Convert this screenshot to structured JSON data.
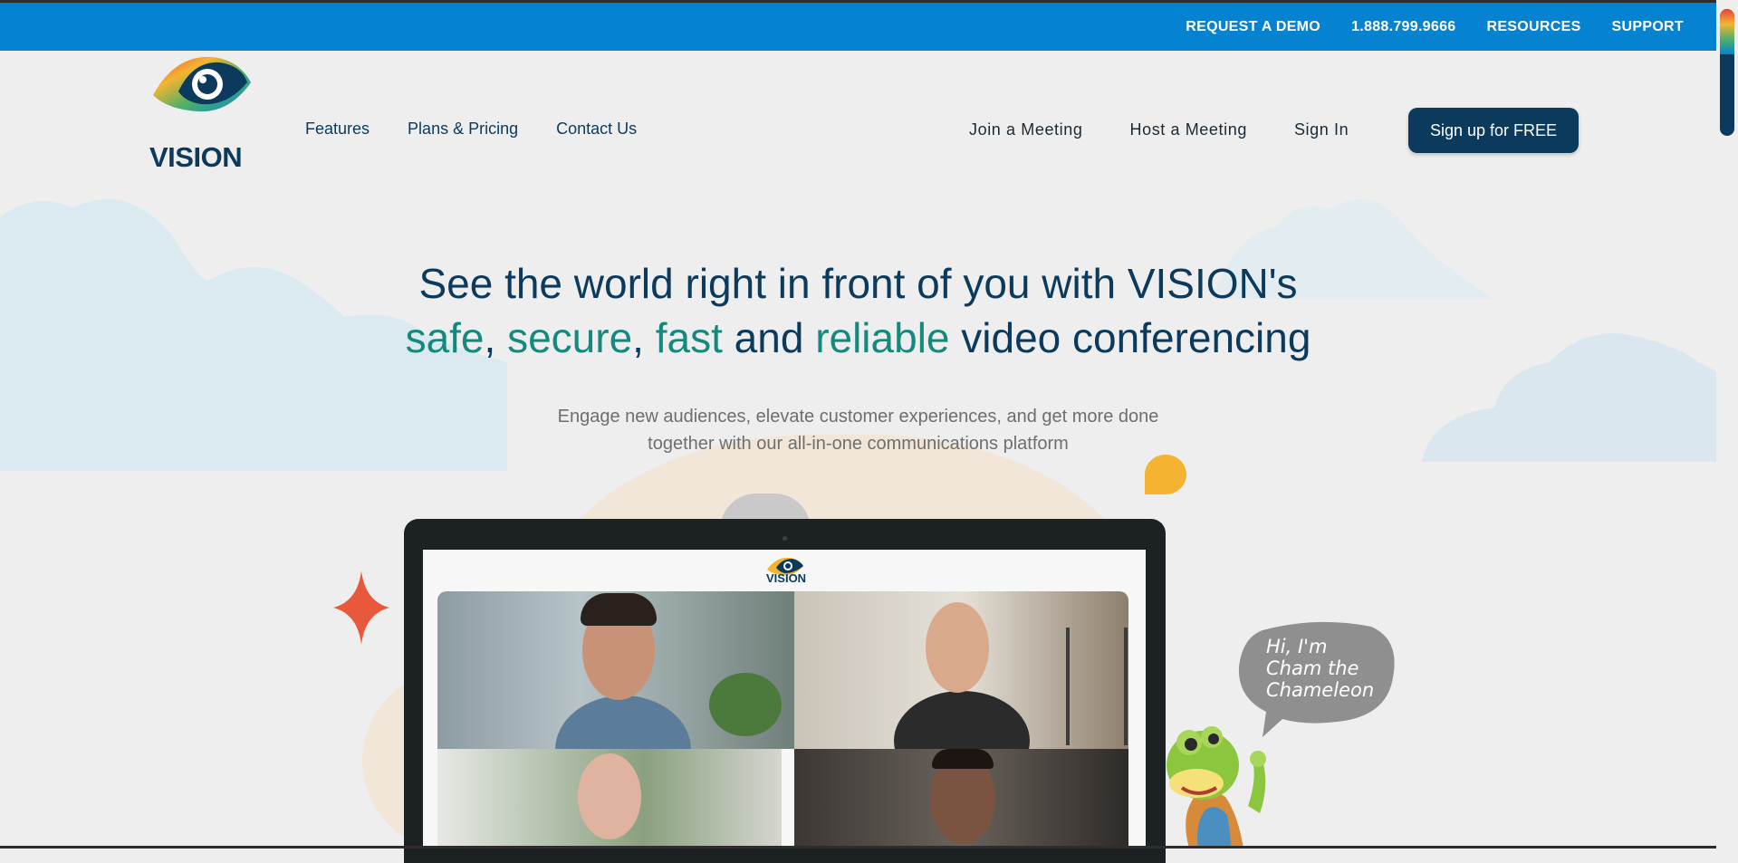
{
  "topbar": {
    "links": [
      "REQUEST A DEMO",
      "1.888.799.9666",
      "RESOURCES",
      "SUPPORT"
    ]
  },
  "brand": {
    "name": "VISION",
    "primary_color": "#0b3a5c",
    "accent_color": "#15897d",
    "topbar_color": "#0583d0"
  },
  "nav": {
    "left": [
      "Features",
      "Plans & Pricing",
      "Contact Us"
    ],
    "join": "Join a Meeting",
    "host": "Host a Meeting",
    "signin": "Sign In",
    "signup": "Sign up for FREE"
  },
  "hero": {
    "line1": "See the world right in front of you with VISION's",
    "w_safe": "safe",
    "comma1": ", ",
    "w_secure": "secure",
    "comma2": ", ",
    "w_fast": "fast",
    "and": " and ",
    "w_reliable": "reliable",
    "rest": " video conferencing",
    "sub1": "Engage new audiences, elevate customer experiences, and get more done",
    "sub2": "together with our all-in-one communications platform"
  },
  "screen": {
    "logo_text": "VISION"
  },
  "mascot": {
    "speech": "Hi, I'm Cham the Chameleon"
  }
}
